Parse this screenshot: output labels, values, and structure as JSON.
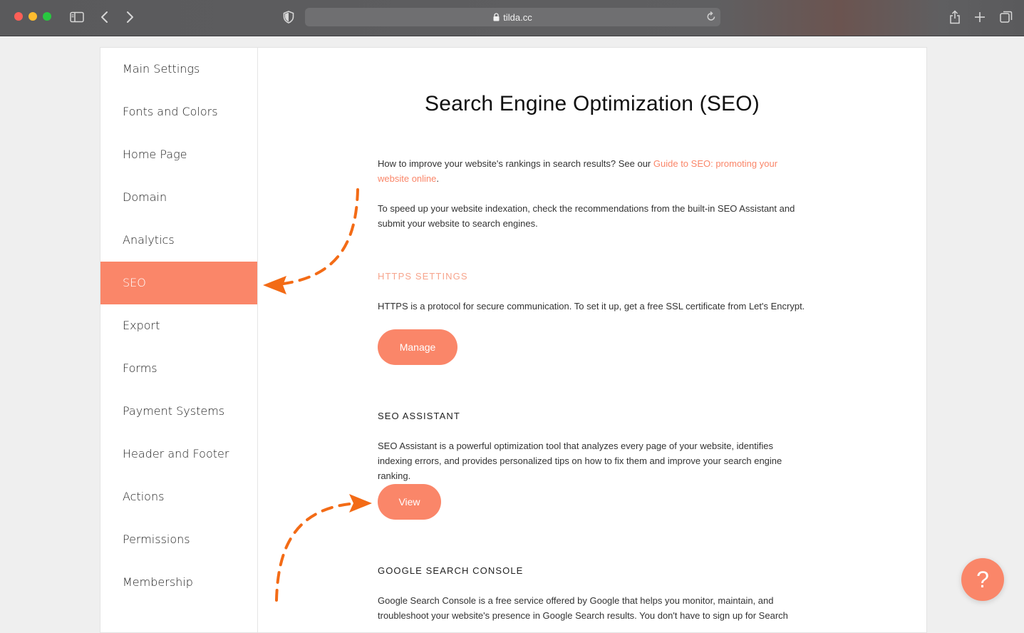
{
  "browser": {
    "url": "tilda.cc",
    "icons": [
      "sidebar-icon",
      "back-arrow-icon",
      "forward-arrow-icon",
      "shield-icon",
      "lock-icon",
      "reload-icon",
      "share-icon",
      "plus-icon",
      "tabs-icon"
    ]
  },
  "sidebar": {
    "items": [
      {
        "label": "Main Settings"
      },
      {
        "label": "Fonts and Colors"
      },
      {
        "label": "Home Page"
      },
      {
        "label": "Domain"
      },
      {
        "label": "Analytics"
      },
      {
        "label": "SEO",
        "active": true
      },
      {
        "label": "Export"
      },
      {
        "label": "Forms"
      },
      {
        "label": "Payment Systems"
      },
      {
        "label": "Header and Footer"
      },
      {
        "label": "Actions"
      },
      {
        "label": "Permissions"
      },
      {
        "label": "Membership"
      }
    ]
  },
  "main": {
    "title": "Search Engine Optimization (SEO)",
    "intro_text": "How to improve your website's rankings in search results? See our ",
    "intro_link": "Guide to SEO: promoting your website online",
    "intro_end": ".",
    "indexation_text": "To speed up your website indexation, check the recommendations from the built-in SEO Assistant and submit your website to search engines.",
    "https": {
      "heading": "HTTPS SETTINGS",
      "text": "HTTPS is a protocol for secure communication. To set it up, get a free SSL certificate from Let's Encrypt.",
      "button": "Manage"
    },
    "assistant": {
      "heading": "SEO ASSISTANT",
      "text": "SEO Assistant is a powerful optimization tool that analyzes every page of your website, identifies indexing errors, and provides personalized tips on how to fix them and improve your search engine ranking.",
      "button": "View"
    },
    "console": {
      "heading": "GOOGLE SEARCH CONSOLE",
      "text": "Google Search Console is a free service offered by Google that helps you monitor, maintain, and troubleshoot your website's presence in Google Search results. You don't have to sign up for Search"
    }
  },
  "help_button": {
    "label": "?"
  },
  "colors": {
    "accent": "#fa8669",
    "annotation_arrow": "#f36b16"
  }
}
